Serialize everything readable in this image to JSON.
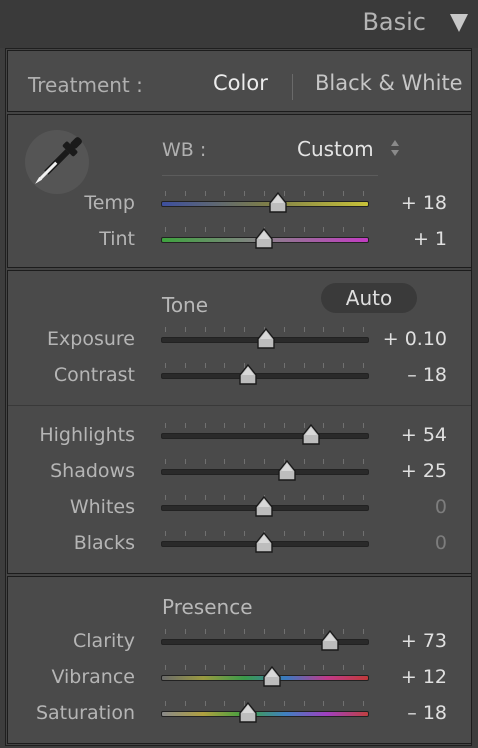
{
  "header": {
    "title": "Basic"
  },
  "treatment": {
    "label": "Treatment :",
    "color": "Color",
    "bw": "Black & White"
  },
  "wb": {
    "label": "WB :",
    "value": "Custom"
  },
  "sliders_wb": [
    {
      "label": "Temp",
      "value": "+ 18",
      "position": 0.57,
      "zero": false
    },
    {
      "label": "Tint",
      "value": "+ 1",
      "position": 0.5,
      "zero": false
    }
  ],
  "tone": {
    "title": "Tone",
    "auto": "Auto"
  },
  "sliders_tone": [
    {
      "label": "Exposure",
      "value": "+ 0.10",
      "position": 0.51,
      "zero": false
    },
    {
      "label": "Contrast",
      "value": "– 18",
      "position": 0.42,
      "zero": false
    }
  ],
  "sliders_tone2": [
    {
      "label": "Highlights",
      "value": "+ 54",
      "position": 0.73,
      "zero": false
    },
    {
      "label": "Shadows",
      "value": "+ 25",
      "position": 0.61,
      "zero": false
    },
    {
      "label": "Whites",
      "value": "0",
      "position": 0.5,
      "zero": true
    },
    {
      "label": "Blacks",
      "value": "0",
      "position": 0.5,
      "zero": true
    }
  ],
  "presence": {
    "title": "Presence"
  },
  "sliders_presence": [
    {
      "label": "Clarity",
      "value": "+ 73",
      "position": 0.82,
      "zero": false
    },
    {
      "label": "Vibrance",
      "value": "+ 12",
      "position": 0.54,
      "zero": false
    },
    {
      "label": "Saturation",
      "value": "– 18",
      "position": 0.42,
      "zero": false
    }
  ],
  "colors": {
    "temp_gradient": [
      "#3d4f9e",
      "#7d7d4a",
      "#c8c23a"
    ],
    "tint_gradient": [
      "#3ea33e",
      "#8a7f8a",
      "#c23cc2"
    ],
    "neutral_track": "#2a2a2a",
    "vibrance_gradient": [
      "#6b6b6b",
      "#9a9a40",
      "#3a9a4a",
      "#3a7ac0",
      "#c03a8a",
      "#c03a3a"
    ],
    "saturation_gradient": [
      "#8a8a8a",
      "#b0a040",
      "#40a040",
      "#4080c0",
      "#a040c0",
      "#c04040"
    ]
  },
  "icons": {
    "dropdown_triangle": "triangle-down-icon",
    "eyedropper": "eyedropper-icon",
    "wb_stepper": "up-down-arrows-icon"
  }
}
